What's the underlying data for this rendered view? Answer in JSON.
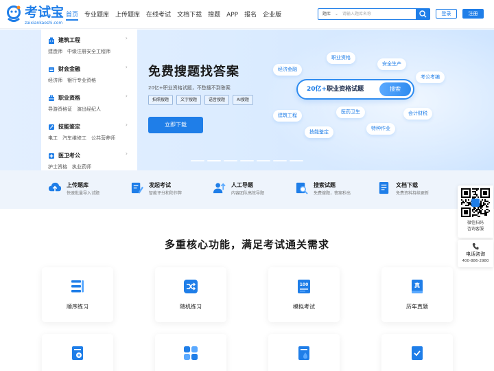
{
  "brand": {
    "name": "考试宝",
    "domain": "zaixiankaoshi.com",
    "primary_color": "#1f7ee8"
  },
  "nav": {
    "items": [
      "首页",
      "专业题库",
      "上传题库",
      "在线考试",
      "文档下载",
      "搜题",
      "APP",
      "报名",
      "企业版"
    ],
    "active_index": 0
  },
  "search": {
    "scope": "题库",
    "placeholder": "请输入题库名称"
  },
  "auth": {
    "login": "登录",
    "register": "注册"
  },
  "sidebar": {
    "categories": [
      {
        "title": "建筑工程",
        "icon": "building-icon",
        "subs": [
          "建造师",
          "中级注册安全工程师"
        ]
      },
      {
        "title": "财会金融",
        "icon": "finance-icon",
        "subs": [
          "经济师",
          "银行专业资格"
        ]
      },
      {
        "title": "职业资格",
        "icon": "briefcase-icon",
        "subs": [
          "导游资格证",
          "演出经纪人"
        ]
      },
      {
        "title": "技能鉴定",
        "icon": "tools-icon",
        "subs": [
          "电工",
          "汽车维修工",
          "公共营养师"
        ]
      },
      {
        "title": "医卫考公",
        "icon": "medical-icon",
        "subs": [
          "护士资格",
          "执业药师"
        ]
      }
    ]
  },
  "hero": {
    "title": "免费搜题找答案",
    "subtitle": "20亿+职业资格试题，不愁搜不到答案",
    "tags": [
      "拍照搜题",
      "文字搜题",
      "语音搜题",
      "AI搜题"
    ],
    "cta": "立即下载",
    "search_text_highlight": "20亿+",
    "search_text_rest": "职业资格试题",
    "search_button": "搜索",
    "bubbles": [
      "职业资格",
      "安全生产",
      "经济金融",
      "考公考编",
      "建筑工程",
      "医药卫生",
      "会计财税",
      "技能鉴定",
      "特种作业"
    ]
  },
  "features": [
    {
      "title": "上传题库",
      "desc": "快速批量导入试题",
      "icon": "upload-cloud-icon"
    },
    {
      "title": "发起考试",
      "desc": "智能评分和防作弊",
      "icon": "exam-edit-icon"
    },
    {
      "title": "人工导题",
      "desc": "内容团队高效导题",
      "icon": "user-upload-icon"
    },
    {
      "title": "搜索试题",
      "desc": "免费搜题，答案秒出",
      "icon": "search-doc-icon"
    },
    {
      "title": "文档下载",
      "desc": "免费资料持续更新",
      "icon": "doc-download-icon"
    }
  ],
  "core": {
    "title": "多重核心功能，满足考试通关需求",
    "cards": [
      {
        "label": "顺序练习",
        "icon": "list-order-icon"
      },
      {
        "label": "随机练习",
        "icon": "shuffle-icon"
      },
      {
        "label": "模拟考试",
        "icon": "mock-exam-icon",
        "badge": "100"
      },
      {
        "label": "历年真题",
        "icon": "real-exam-book-icon",
        "badge": "真"
      },
      {
        "label": "",
        "icon": "doc-settings-icon"
      },
      {
        "label": "",
        "icon": "apps-grid-icon"
      },
      {
        "label": "",
        "icon": "doc-water-icon"
      },
      {
        "label": "",
        "icon": "checklist-icon"
      }
    ]
  },
  "float_widget": {
    "qr_line1": "微信扫码",
    "qr_line2": "咨询客服",
    "phone_title": "电话咨询",
    "phone_number": "400-886-2980"
  }
}
